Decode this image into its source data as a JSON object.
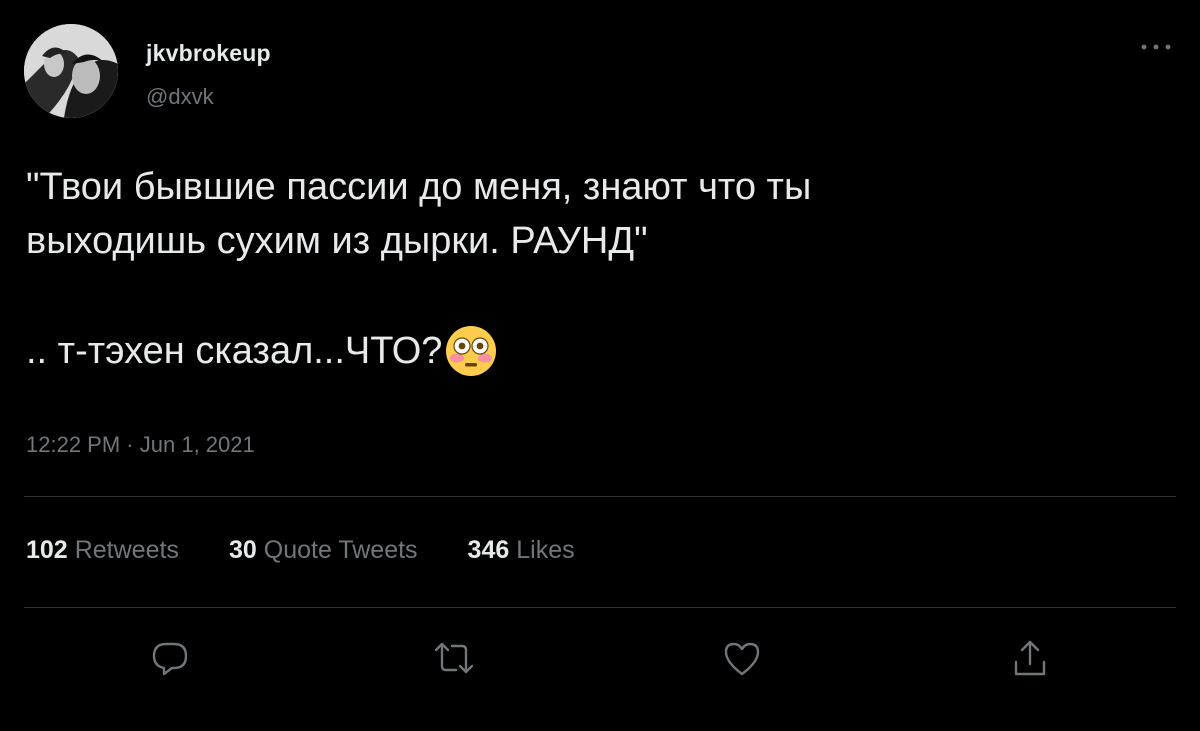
{
  "author": {
    "display_name": "jkvbrokeup",
    "handle": "@dxvk",
    "avatar_icon": "profile-photo"
  },
  "tweet": {
    "line1": "\"Твои бывшие пассии до меня, знают что ты",
    "line2": "выходишь сухим из дырки. РАУНД\"",
    "line3": ".. т-тэхен сказал...ЧТО?",
    "emoji": "flushed-face-emoji"
  },
  "meta": {
    "time": "12:22 PM",
    "separator": "·",
    "date": "Jun 1, 2021"
  },
  "stats": {
    "retweets_count": "102",
    "retweets_label": "Retweets",
    "quotes_count": "30",
    "quotes_label": "Quote Tweets",
    "likes_count": "346",
    "likes_label": "Likes"
  },
  "actions": [
    "reply-icon",
    "retweet-icon",
    "like-icon",
    "share-icon"
  ],
  "colors": {
    "background": "#000000",
    "text_primary": "#e7e9ea",
    "text_secondary": "#71767b",
    "divider": "#2f3336"
  }
}
